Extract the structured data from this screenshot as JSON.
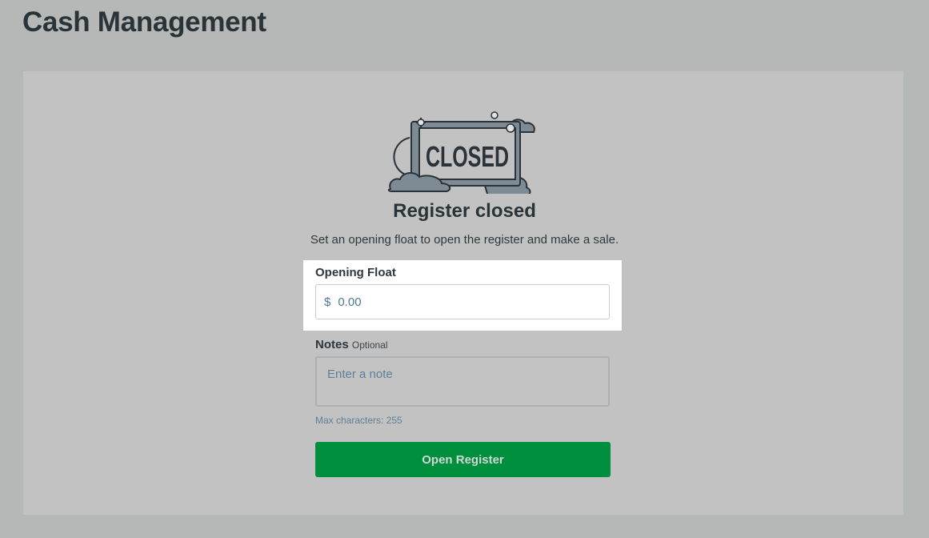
{
  "page": {
    "title": "Cash Management"
  },
  "register": {
    "sign_text": "CLOSED",
    "heading": "Register closed",
    "description": "Set an opening float to open the register and make a sale."
  },
  "opening_float": {
    "label": "Opening Float",
    "currency_symbol": "$",
    "placeholder": "0.00"
  },
  "notes": {
    "label": "Notes",
    "optional_label": "Optional",
    "placeholder": "Enter a note",
    "max_chars": "Max characters: 255"
  },
  "actions": {
    "open_register_label": "Open Register"
  },
  "colors": {
    "primary_button": "#008f3c",
    "page_background": "#b6b8b8",
    "card_background": "#c2c2c2",
    "input_text": "#4d7a9a"
  },
  "icons": {
    "illustration": "closed-sign-icon"
  }
}
